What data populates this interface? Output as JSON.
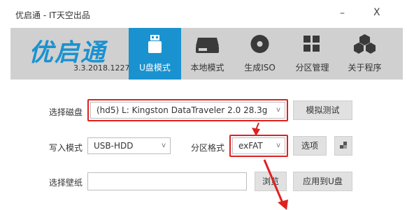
{
  "window": {
    "title": "优启通 - IT天空出品",
    "minimize": "–",
    "close": "X"
  },
  "brand": {
    "logo_text": "优启通",
    "version": "3.3.2018.1227"
  },
  "tabs": [
    {
      "label": "U盘模式",
      "icon": "usb-drive-icon",
      "active": true
    },
    {
      "label": "本地模式",
      "icon": "hard-drive-icon",
      "active": false
    },
    {
      "label": "生成ISO",
      "icon": "disc-icon",
      "active": false
    },
    {
      "label": "分区管理",
      "icon": "partition-grid-icon",
      "active": false
    },
    {
      "label": "关于程序",
      "icon": "cubes-icon",
      "active": false
    }
  ],
  "form": {
    "disk": {
      "label": "选择磁盘",
      "value": "(hd5) L: Kingston DataTraveler 2.0 28.3g",
      "arrow": "v"
    },
    "simulate_button": "模拟测试",
    "write_mode": {
      "label": "写入模式",
      "value": "USB-HDD",
      "arrow": "v"
    },
    "partition_format": {
      "label": "分区格式",
      "value": "exFAT",
      "arrow": "v"
    },
    "options_button": "选项",
    "wallpaper": {
      "label": "选择壁纸",
      "value": ""
    },
    "browse_button": "浏览",
    "apply_button": "应用到U盘"
  },
  "colors": {
    "accent": "#1b92d0",
    "highlight": "#e02020",
    "header_bg": "#d0d0d0"
  }
}
